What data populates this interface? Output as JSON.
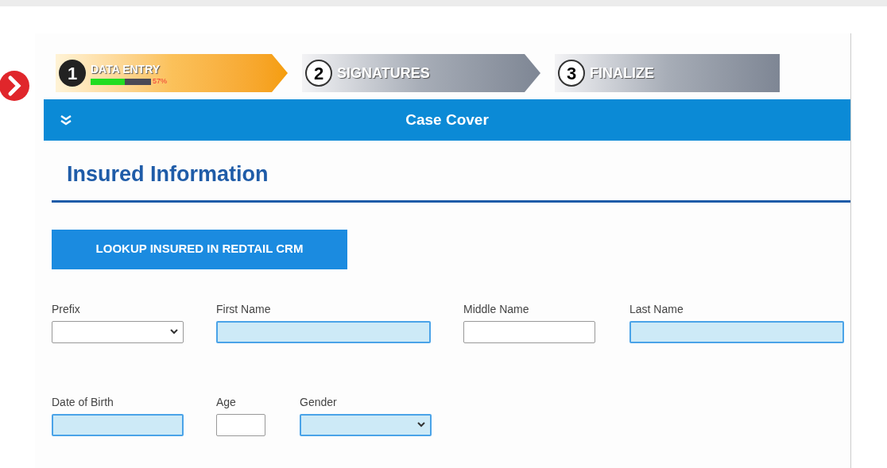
{
  "steps": [
    {
      "number": "1",
      "label": "DATA ENTRY",
      "selected": true,
      "level": 0.57,
      "reading": "57%"
    },
    {
      "number": "2",
      "label": "SIGNATURES",
      "selected": false
    },
    {
      "number": "3",
      "label": "FINALIZE",
      "selected": false
    }
  ],
  "panel": {
    "title": "Case Cover",
    "expanded": true
  },
  "section": {
    "title": "Insured Information"
  },
  "lookup_button": "LOOKUP INSURED IN REDTAIL CRM",
  "field_rows": [
    [
      {
        "label": "Prefix",
        "kind": "select",
        "required": false
      },
      {
        "label": "First Name",
        "kind": "text",
        "required": true
      },
      {
        "label": "Middle Name",
        "kind": "text",
        "required": false
      },
      {
        "label": "Last Name",
        "kind": "text",
        "required": true
      }
    ],
    [
      {
        "label": "Date of Birth",
        "kind": "text",
        "required": true
      },
      {
        "label": "Age",
        "kind": "text",
        "required": false
      },
      {
        "label": "Gender",
        "kind": "select",
        "required": true
      }
    ]
  ]
}
